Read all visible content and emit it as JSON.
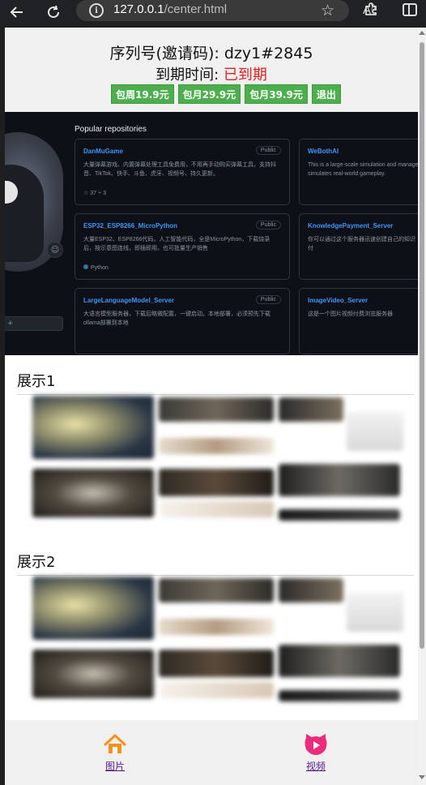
{
  "browser": {
    "url_host": "127.0.0.1",
    "url_path": "/center.html",
    "read_aloud_label": "A",
    "icons": [
      "back-arrow-icon",
      "reload-icon",
      "info-icon",
      "read-aloud-icon",
      "favorite-star-icon",
      "extensions-icon",
      "split-screen-icon"
    ]
  },
  "header": {
    "serial_label": "序列号(邀请码): ",
    "serial_value": "dzy1#2845",
    "expire_label": "到期时间: ",
    "expire_value": "已到期",
    "expire_color": "#e02020",
    "buttons": [
      {
        "label": "包周19.9元"
      },
      {
        "label": "包月29.9元"
      },
      {
        "label": "包月39.9元"
      },
      {
        "label": "退出"
      }
    ],
    "button_color": "#4cae4c"
  },
  "github_preview": {
    "section_title": "Popular repositories",
    "repos": [
      {
        "name": "DanMuGame",
        "badge": "Public",
        "desc": "大量弹幕游戏、内置弹幕处理工具免费用，不用再手动购买弹幕工具，支持抖音、TikTok、快手、斗鱼、虎牙、视频号、持久更新。",
        "meta": "☆ 37   ⑂ 3"
      },
      {
        "name": "WeBothAI",
        "badge": "",
        "desc": "This is a large-scale simulation and manage simulates real-world gameplay.",
        "meta": ""
      },
      {
        "name": "ESP32_ESP8266_MicroPython",
        "badge": "Public",
        "desc": "大量ESP32、ESP8266代码，人工智能代码，全是MicroPython，下载烧录后，按示意图连线，即插即用。也可批量生产销售",
        "meta": "Python"
      },
      {
        "name": "KnowledgePayment_Server",
        "badge": "",
        "desc": "你可以通过这个服务器迅速创建自己的知识付",
        "meta": ""
      },
      {
        "name": "LargeLanguageModel_Server",
        "badge": "Public",
        "desc": "大语言模型服务器，下载后略微配置，一键启动。本地部署，必须预先下载ollama部署到本地",
        "meta": ""
      },
      {
        "name": "ImageVideo_Server",
        "badge": "",
        "desc": "这是一个图片视频付费浏览服务器",
        "meta": ""
      }
    ],
    "follow_label": "+"
  },
  "sections": [
    {
      "title": "展示1"
    },
    {
      "title": "展示2"
    }
  ],
  "bottom_nav": {
    "items": [
      {
        "label": "图片",
        "icon": "home-icon"
      },
      {
        "label": "视频",
        "icon": "video-cat-icon"
      }
    ]
  }
}
